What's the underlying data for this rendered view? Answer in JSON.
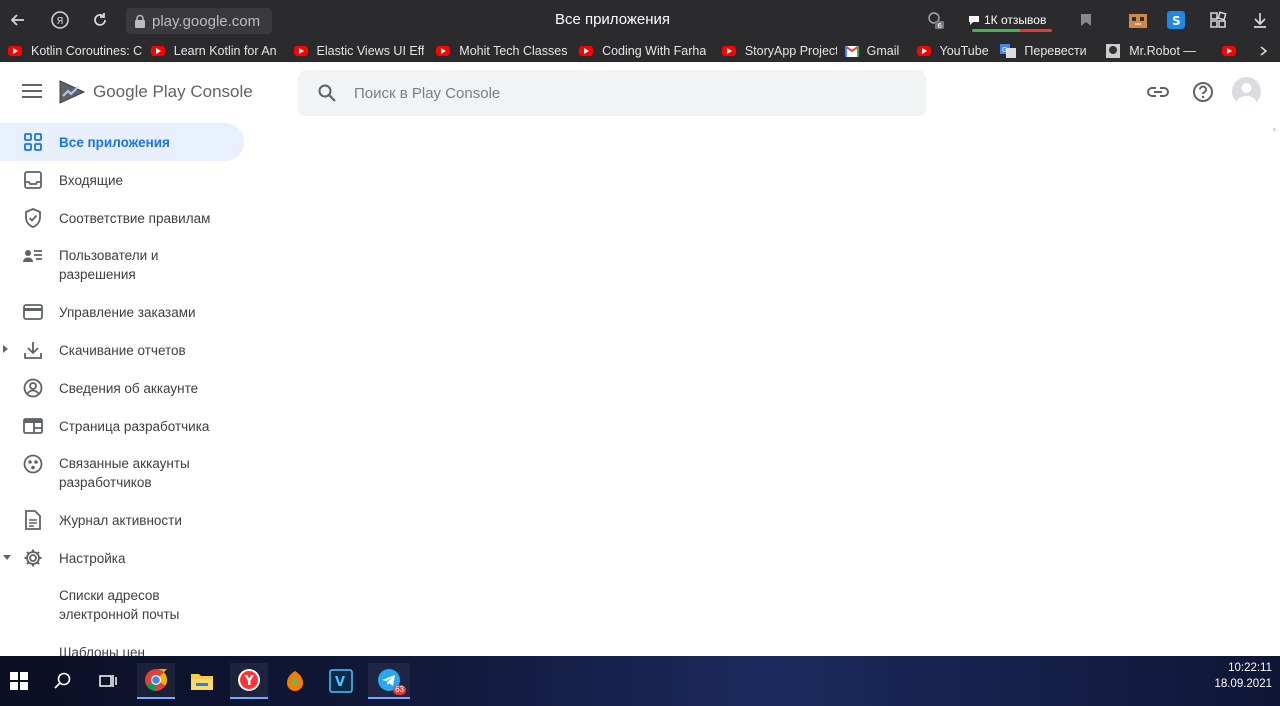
{
  "browser": {
    "url": "play.google.com",
    "page_title": "Все приложения",
    "reviews_label": "1К отзывов",
    "tab_count": "6",
    "bookmarks": [
      "Kotlin Coroutines: C",
      "Learn Kotlin for An",
      "Elastic Views UI Eff",
      "Mohit Tech Classes",
      "Coding With Farha",
      "StoryApp Project V",
      "Gmail",
      "YouTube",
      "Перевести",
      "Mr.Robot —"
    ]
  },
  "header": {
    "brand": "Google Play Console",
    "search_placeholder": "Поиск в Play Console"
  },
  "sidebar": {
    "items": [
      {
        "label": "Все приложения"
      },
      {
        "label": "Входящие"
      },
      {
        "label": "Соответствие правилам"
      },
      {
        "label": "Пользователи и разрешения"
      },
      {
        "label": "Управление заказами"
      },
      {
        "label": "Скачивание отчетов"
      },
      {
        "label": "Сведения об аккаунте"
      },
      {
        "label": "Страница разработчика"
      },
      {
        "label": "Связанные аккаунты разработчиков"
      },
      {
        "label": "Журнал активности"
      },
      {
        "label": "Настройка"
      },
      {
        "label": "Списки адресов электронной почты"
      },
      {
        "label": "Шаблоны цен"
      }
    ]
  },
  "taskbar": {
    "telegram_badge": "63",
    "time": "10:22:11",
    "date": "18.09.2021"
  },
  "colors": {
    "accent": "#1a73e8",
    "active_bg": "#e8f0fe",
    "browser_bg": "#2b2b2e"
  }
}
